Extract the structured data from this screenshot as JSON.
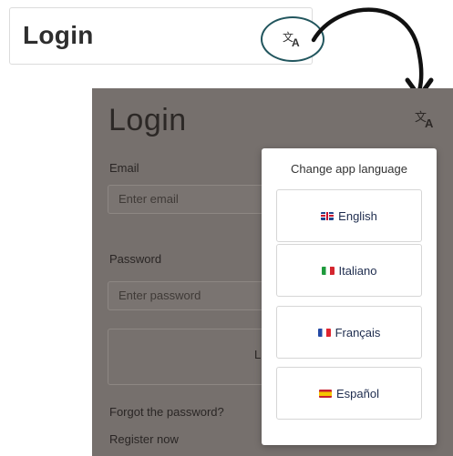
{
  "top": {
    "title": "Login",
    "translate_icon": "translate-icon"
  },
  "screen": {
    "title": "Login",
    "translate_icon": "translate-icon",
    "email_label": "Email",
    "email_placeholder": "Enter email",
    "password_label": "Password",
    "password_placeholder": "Enter password",
    "button_partial": "L",
    "forgot_link": "Forgot the password?",
    "register_link": "Register now"
  },
  "language_popup": {
    "title": "Change app language",
    "options": [
      {
        "label": "English",
        "flag": "uk-flag-icon"
      },
      {
        "label": "Italiano",
        "flag": "italy-flag-icon"
      },
      {
        "label": "Français",
        "flag": "france-flag-icon"
      },
      {
        "label": "Español",
        "flag": "spain-flag-icon"
      }
    ]
  },
  "colors": {
    "accent_circle": "#22565e",
    "overlay": "#76706d",
    "lang_text": "#1e2c4e"
  }
}
